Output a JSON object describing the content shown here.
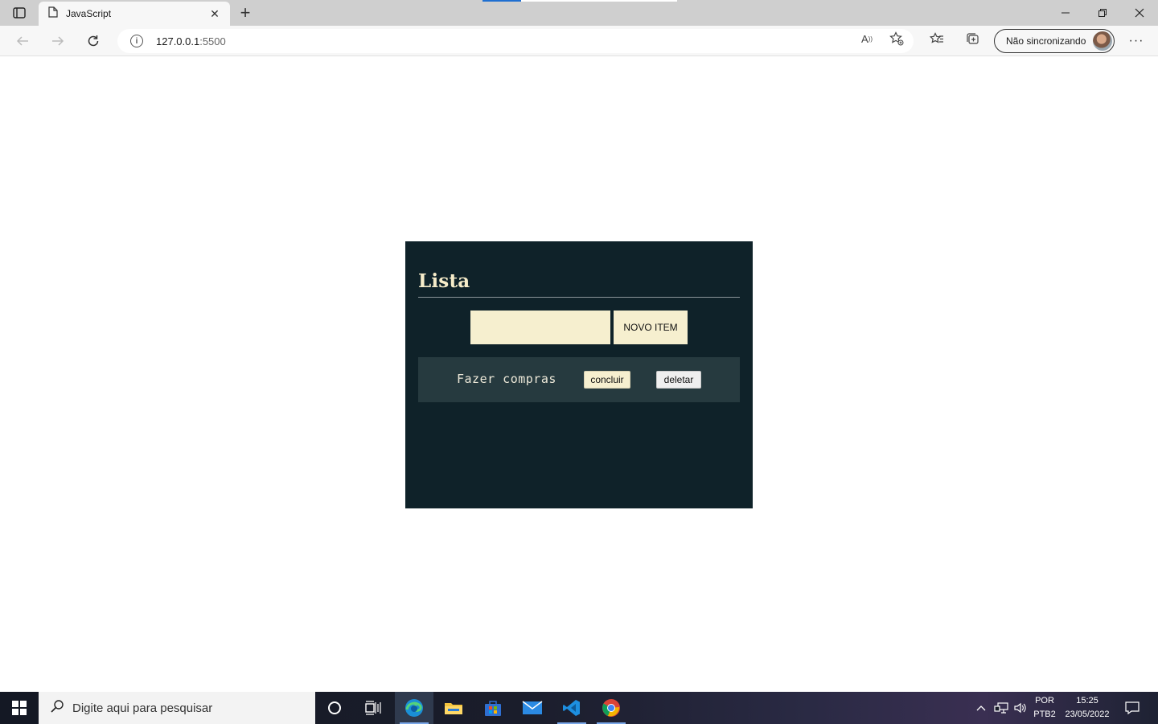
{
  "browser": {
    "tab_title": "JavaScript",
    "url_host": "127.0.0.1",
    "url_port": ":5500",
    "sync_label": "Não sincronizando"
  },
  "page": {
    "heading": "Lista",
    "input_value": "",
    "add_button_label": "NOVO ITEM",
    "items": [
      {
        "text": "Fazer compras",
        "done_label": "concluir",
        "delete_label": "deletar"
      }
    ],
    "colors": {
      "panel_bg": "#0f2229",
      "item_bg": "#263a3f",
      "accent_cream": "#f6efcf"
    }
  },
  "taskbar": {
    "search_placeholder": "Digite aqui para pesquisar",
    "lang_line1": "POR",
    "lang_line2": "PTB2",
    "time": "15:25",
    "date": "23/05/2022",
    "icons": [
      "cortana-icon",
      "task-view-icon",
      "edge-icon",
      "file-explorer-icon",
      "store-icon",
      "mail-icon",
      "vscode-icon",
      "chrome-icon"
    ]
  }
}
